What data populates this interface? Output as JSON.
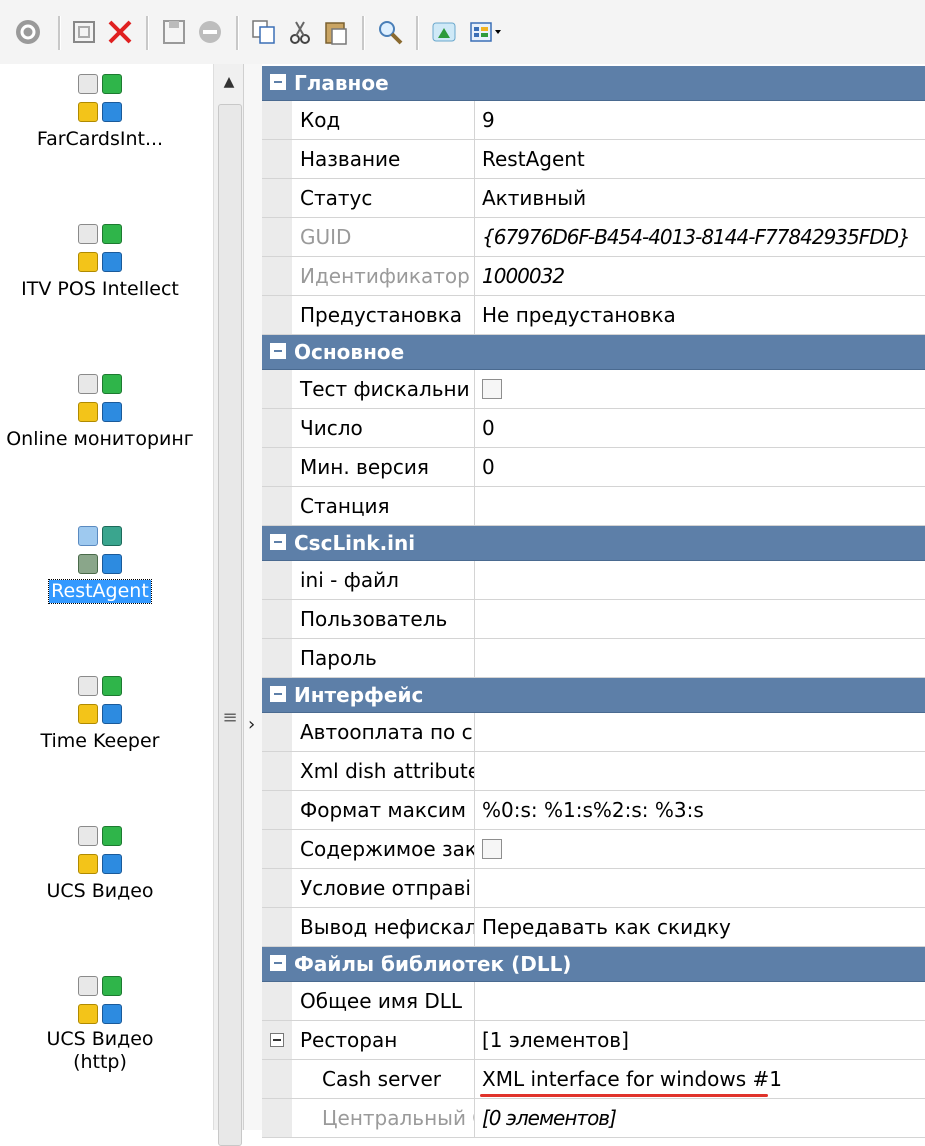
{
  "toolbar": {
    "icons": [
      "refresh-icon",
      "new-item-icon",
      "delete-icon",
      "save-icon",
      "cancel-icon",
      "copy-icon",
      "cut-icon",
      "paste-icon",
      "search-icon",
      "filter-icon",
      "view-dropdown-icon"
    ]
  },
  "modules": [
    {
      "label": "FarCardsInt..."
    },
    {
      "label": "ITV POS Intellect"
    },
    {
      "label": "Online мониторинг"
    },
    {
      "label": "RestAgent"
    },
    {
      "label": "Time Keeper"
    },
    {
      "label": "UCS Видео"
    },
    {
      "label": "UCS Видео (http)"
    }
  ],
  "properties": {
    "cat_main": "Главное",
    "kod": {
      "name": "Код",
      "value": "9"
    },
    "nazvanie": {
      "name": "Название",
      "value": "RestAgent"
    },
    "status": {
      "name": "Статус",
      "value": "Активный"
    },
    "guid": {
      "name": "GUID",
      "value": "{67976D6F-B454-4013-8144-F77842935FDD}"
    },
    "ident": {
      "name": "Идентификатор",
      "value": "1000032"
    },
    "preset": {
      "name": "Предустановка",
      "value": "Не предустановка"
    },
    "cat_basic": "Основное",
    "test_fiscal": {
      "name": "Тест фискальни",
      "checked": false
    },
    "chislo": {
      "name": "Число",
      "value": "0"
    },
    "min_version": {
      "name": "Мин. версия",
      "value": "0"
    },
    "station": {
      "name": "Станция",
      "value": ""
    },
    "cat_csclink": "CscLink.ini",
    "ini_file": {
      "name": "ini - файл",
      "value": ""
    },
    "user": {
      "name": "Пользователь",
      "value": ""
    },
    "password": {
      "name": "Пароль",
      "value": ""
    },
    "cat_interface": "Интерфейс",
    "autopay": {
      "name": "Автооплата по с",
      "value": ""
    },
    "xml_dish": {
      "name": "Xml dish attributes",
      "value": ""
    },
    "format_max": {
      "name": "Формат максим",
      "value": "%0:s: %1:s%2:s: %3:s"
    },
    "content": {
      "name": "Содержимое зак",
      "checked": false
    },
    "condition": {
      "name": "Условие отправі",
      "value": ""
    },
    "nonfiscal": {
      "name": "Вывод нефискал",
      "value": "Передавать как скидку"
    },
    "cat_dll": "Файлы библиотек (DLL)",
    "dll_name": {
      "name": "Общее имя DLL",
      "value": ""
    },
    "restaurant": {
      "name": "Ресторан",
      "value": "[1 элементов]"
    },
    "cash_server": {
      "name": "Cash server",
      "value": "XML interface for windows #1"
    },
    "central_office": {
      "name": "Центральный Оф",
      "value": "[0 элементов]"
    }
  },
  "colors": {
    "category_header": "#5d7fa8",
    "selection": "#3399ff",
    "annotation_underline": "#e0322a"
  }
}
